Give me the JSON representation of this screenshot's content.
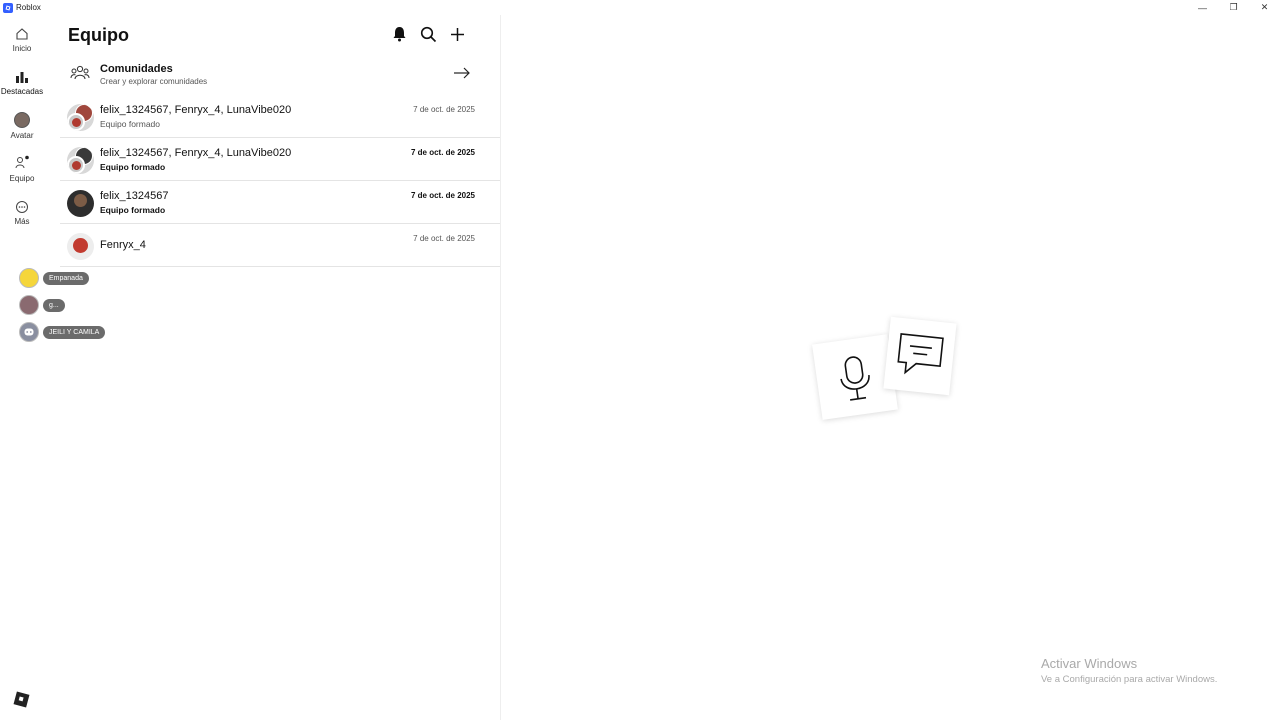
{
  "window": {
    "title": "Roblox",
    "controls": [
      "—",
      "❐",
      "✕"
    ]
  },
  "nav": {
    "items": [
      {
        "label": "Inicio",
        "icon": "home-icon"
      },
      {
        "label": "Destacadas",
        "icon": "charts-icon"
      },
      {
        "label": "Avatar",
        "icon": "avatar-icon"
      },
      {
        "label": "Equipo",
        "icon": "party-icon"
      },
      {
        "label": "Más",
        "icon": "more-icon"
      }
    ]
  },
  "quick_access": [
    {
      "label": "Empanada"
    },
    {
      "label": "g..."
    },
    {
      "label": "JEILI Y CAMILA"
    }
  ],
  "panel": {
    "title": "Equipo",
    "icons": [
      "notification-bell-icon",
      "search-icon",
      "plus-icon"
    ],
    "communities": {
      "title": "Comunidades",
      "subtitle": "Crear y explorar comunidades"
    },
    "conversations": [
      {
        "name": "felix_1324567, Fenryx_4, LunaVibe020",
        "subtitle": "Equipo formado",
        "date": "7 de oct. de 2025",
        "unread": false
      },
      {
        "name": "felix_1324567, Fenryx_4, LunaVibe020",
        "subtitle": "Equipo formado",
        "date": "7 de oct. de 2025",
        "unread": true
      },
      {
        "name": "felix_1324567",
        "subtitle": "Equipo formado",
        "date": "7 de oct. de 2025",
        "unread": true
      },
      {
        "name": "Fenryx_4",
        "subtitle": "",
        "date": "7 de oct. de 2025",
        "unread": false
      }
    ]
  },
  "watermark": {
    "line1": "Activar Windows",
    "line2": "Ve a Configuración para activar Windows."
  }
}
